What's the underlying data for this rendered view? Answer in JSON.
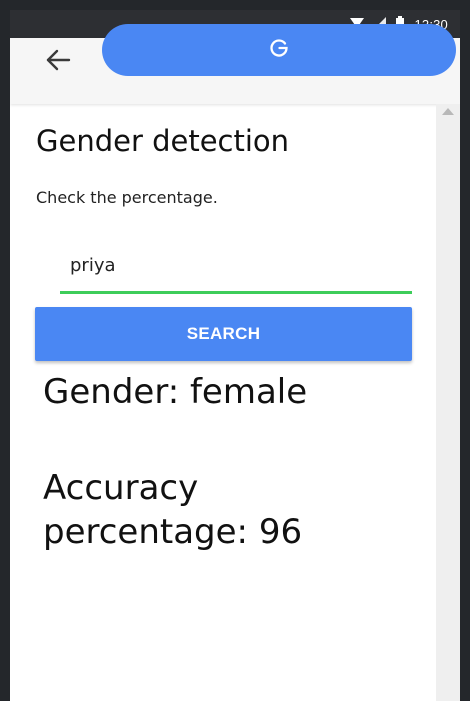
{
  "status_bar": {
    "time": "12:30",
    "icons": [
      "wifi-icon",
      "signal-icon",
      "battery-icon"
    ]
  },
  "app_bar": {
    "back_icon": "arrow-back-icon",
    "pill_icon": "google-g-icon",
    "accent": "#4a87f3"
  },
  "page": {
    "title": "Gender detection",
    "subtitle": "Check the percentage."
  },
  "form": {
    "name_value": "priya",
    "underline_color": "#3dcd5a",
    "search_label": "SEARCH"
  },
  "result": {
    "gender_text": "Gender: female",
    "accuracy_text": "Accuracy percentage: 96"
  }
}
